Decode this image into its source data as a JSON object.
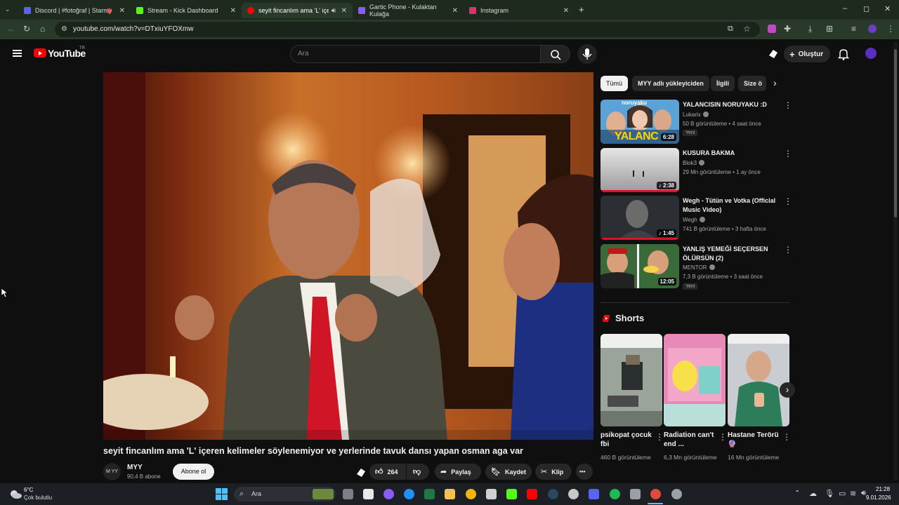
{
  "browser": {
    "tabs": [
      {
        "title": "Discord | #fotoğraf | Starmy",
        "color": "#5865f2"
      },
      {
        "title": "Stream - Kick Dashboard",
        "color": "#53fc18"
      },
      {
        "title": "seyit fincanlım ama 'L' içeren",
        "color": "#ff0000"
      },
      {
        "title": "Gartic Phone - Kulaktan Kulağa",
        "color": "#8a5cf6"
      },
      {
        "title": "Instagram",
        "color": "#e1306c"
      }
    ],
    "new_tab": "+",
    "url": "youtube.com/watch?v=DTxiuYFOXmw",
    "window_controls": [
      "–",
      "◻",
      "✕"
    ]
  },
  "youtube": {
    "brand": "YouTube",
    "country": "TR",
    "search_placeholder": "Ara",
    "create_label": "Oluştur",
    "accent": "#ff0000"
  },
  "video": {
    "title": "seyit fincanlım ama 'L' içeren kelimeler söylenemiyor ve yerlerinde tavuk dansı yapan osman aga var",
    "channel": "MYY",
    "avatar_text": "M YY",
    "subscribers": "90,4 B abone",
    "subscribe_label": "Abone ol",
    "likes": "264",
    "share_label": "Paylaş",
    "save_label": "Kaydet",
    "clip_label": "Klip",
    "more_label": "•••"
  },
  "chips": [
    "Tümü",
    "MYY adlı yükleyiciden",
    "İlgili",
    "Size ö"
  ],
  "recommendations": [
    {
      "title": "YALANCISIN NORUYAKU :D",
      "channel": "Lukarix",
      "meta": "50 B görüntüleme • 4 saat önce",
      "badge": "Yeni",
      "duration": "6:28",
      "thumb_text": "YALANC",
      "thumb_top": "noruyaku"
    },
    {
      "title": "KUSURA BAKMA",
      "channel": "Blok3",
      "meta": "29 Mn görüntüleme • 1 ay önce",
      "badge": "",
      "duration": "♪ 2:38"
    },
    {
      "title": "Wegh - Tütün ve Votka (Official Music Video)",
      "channel": "Wegh",
      "meta": "741 B görüntüleme • 3 hafta önce",
      "badge": "",
      "duration": "♪ 1:45"
    },
    {
      "title": "YANLIŞ YEMEĞİ SEÇERSEN ÖLÜRSÜN (2)",
      "channel": "MENTOR",
      "meta": "7,3 B görüntüleme • 3 saat önce",
      "badge": "Yeni",
      "duration": "12:05"
    }
  ],
  "shorts": {
    "heading": "Shorts",
    "items": [
      {
        "title": "psikopat çocuk fbi",
        "views": "460 B görüntüleme"
      },
      {
        "title": "Radiation can't end ...",
        "views": "6,3 Mn görüntüleme"
      },
      {
        "title": "Hastane Terörü 🔮",
        "views": "16 Mn görüntüleme"
      }
    ]
  },
  "taskbar": {
    "weather_temp": "6°C",
    "weather_desc": "Çok bulutlu",
    "search_label": "Ara",
    "time": "21:28",
    "date": "9.01.2026"
  }
}
